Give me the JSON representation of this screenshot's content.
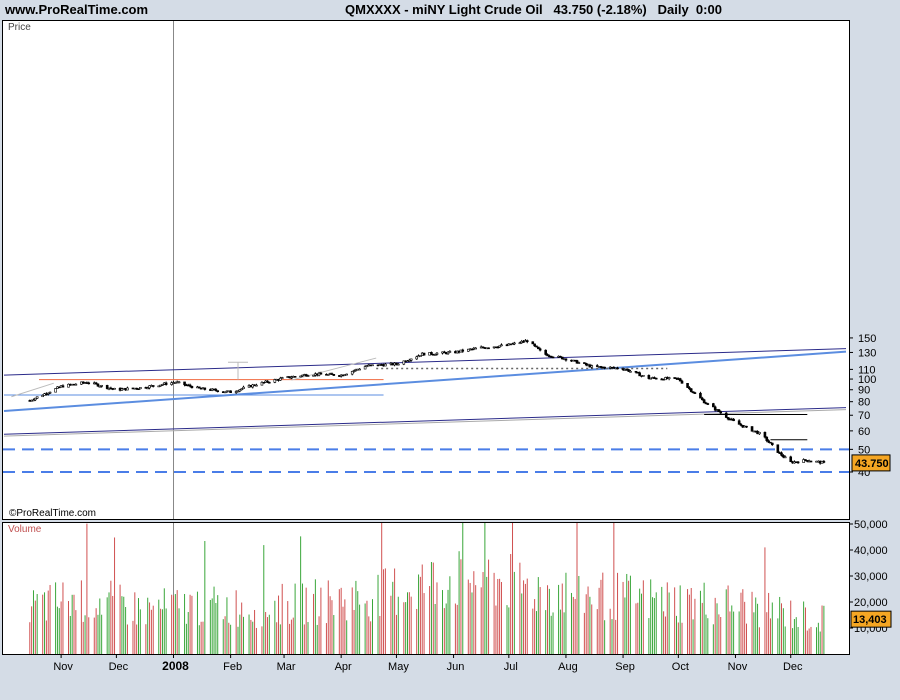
{
  "header": {
    "site": "www.ProRealTime.com",
    "instrument": "QMXXXX - miNY Light Crude Oil",
    "last": "43.750",
    "change": "(-2.18%)",
    "timeframe": "Daily",
    "time": "0:00"
  },
  "price_panel": {
    "label": "Price",
    "copyright": "©ProRealTime.com"
  },
  "volume_panel": {
    "label": "Volume"
  },
  "colors": {
    "background": "#d4dce6",
    "candle": "#000000",
    "trend_light_blue": "#5b8de0",
    "trend_dark_blue": "#2b2b8a",
    "resistance_orange": "#f06a40",
    "support_black": "#000000",
    "dashed_level": "#4a7de8",
    "price_tag": "#f5a623",
    "volume_up": "#3aa63a",
    "volume_down": "#d05050",
    "volume_tag": "#f5a623"
  },
  "chart_data": [
    {
      "type": "candlestick",
      "title": "QMXXXX - miNY Light Crude Oil",
      "ylabel": "Price",
      "y_scale": "log",
      "ylim": [
        37,
        160
      ],
      "x_ticks": [
        "Nov",
        "Dec",
        "2008",
        "Feb",
        "Mar",
        "Apr",
        "May",
        "Jun",
        "Jul",
        "Aug",
        "Sep",
        "Oct",
        "Nov",
        "Dec"
      ],
      "y_ticks": [
        40,
        50,
        60,
        70,
        80,
        90,
        100,
        110,
        130,
        150
      ],
      "last_price": 43.75,
      "last_price_label": "43.750",
      "horizontal_levels": [
        {
          "name": "upper dashed",
          "value": 50
        },
        {
          "name": "lower dashed",
          "value": 40
        }
      ],
      "series": [
        {
          "x": [
            "2007-10-15",
            "2007-11-01",
            "2007-11-15",
            "2007-12-01",
            "2007-12-15",
            "2008-01-02",
            "2008-01-15",
            "2008-02-01",
            "2008-02-15",
            "2008-03-01",
            "2008-03-15",
            "2008-04-01",
            "2008-04-15",
            "2008-05-01",
            "2008-05-15",
            "2008-06-01",
            "2008-06-15",
            "2008-07-01",
            "2008-07-11",
            "2008-07-20",
            "2008-08-01",
            "2008-08-15",
            "2008-09-01",
            "2008-09-15",
            "2008-10-01",
            "2008-10-15",
            "2008-11-01",
            "2008-11-15",
            "2008-11-25",
            "2008-12-01",
            "2008-12-10",
            "2008-12-19"
          ],
          "values": [
            81,
            93,
            97,
            90,
            92,
            97,
            91,
            88,
            95,
            101,
            105,
            104,
            114,
            116,
            128,
            130,
            136,
            140,
            146,
            128,
            122,
            113,
            111,
            101,
            100,
            80,
            65,
            58,
            48,
            44,
            45,
            43.75
          ]
        }
      ]
    },
    {
      "type": "bar",
      "title": "Volume",
      "ylim": [
        0,
        55000
      ],
      "y_ticks": [
        "10,000",
        "20,000",
        "30,000",
        "40,000",
        "50,000"
      ],
      "last_value_label": "13,403",
      "series": [
        {
          "x": [
            "2007-10",
            "2007-11",
            "2007-12",
            "2008-01",
            "2008-02",
            "2008-03",
            "2008-04",
            "2008-05",
            "2008-06",
            "2008-07",
            "2008-08",
            "2008-09",
            "2008-10",
            "2008-11",
            "2008-12"
          ],
          "values": [
            18000,
            22000,
            17000,
            19000,
            18000,
            20000,
            22000,
            27000,
            30000,
            25000,
            23000,
            21000,
            20000,
            18000,
            13403
          ]
        }
      ]
    }
  ]
}
